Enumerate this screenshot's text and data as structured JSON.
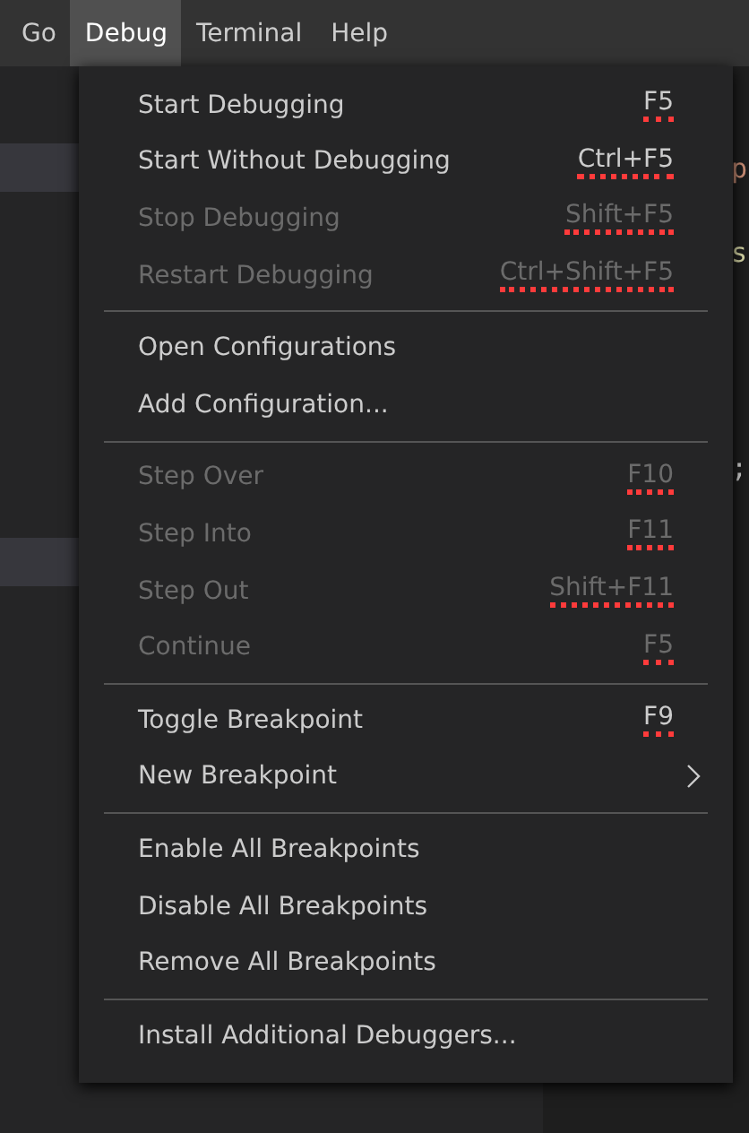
{
  "menubar": [
    {
      "label": "Go",
      "selected": false
    },
    {
      "label": "Debug",
      "selected": true
    },
    {
      "label": "Terminal",
      "selected": false
    },
    {
      "label": "Help",
      "selected": false
    }
  ],
  "editor_fragments": [
    {
      "text": "p"
    },
    {
      "text": "s"
    },
    {
      "text": ";"
    }
  ],
  "menu_groups": [
    [
      {
        "label": "Start Debugging",
        "shortcut": "F5",
        "disabled": false
      },
      {
        "label": "Start Without Debugging",
        "shortcut": "Ctrl+F5",
        "disabled": false
      },
      {
        "label": "Stop Debugging",
        "shortcut": "Shift+F5",
        "disabled": true
      },
      {
        "label": "Restart Debugging",
        "shortcut": "Ctrl+Shift+F5",
        "disabled": true
      }
    ],
    [
      {
        "label": "Open Configurations",
        "disabled": false
      },
      {
        "label": "Add Configuration...",
        "disabled": false
      }
    ],
    [
      {
        "label": "Step Over",
        "shortcut": "F10",
        "disabled": true
      },
      {
        "label": "Step Into",
        "shortcut": "F11",
        "disabled": true
      },
      {
        "label": "Step Out",
        "shortcut": "Shift+F11",
        "disabled": true
      },
      {
        "label": "Continue",
        "shortcut": "F5",
        "disabled": true
      }
    ],
    [
      {
        "label": "Toggle Breakpoint",
        "shortcut": "F9",
        "disabled": false
      },
      {
        "label": "New Breakpoint",
        "disabled": false,
        "submenu": true
      }
    ],
    [
      {
        "label": "Enable All Breakpoints",
        "disabled": false
      },
      {
        "label": "Disable All Breakpoints",
        "disabled": false
      },
      {
        "label": "Remove All Breakpoints",
        "disabled": false
      }
    ],
    [
      {
        "label": "Install Additional Debuggers...",
        "disabled": false
      }
    ]
  ]
}
